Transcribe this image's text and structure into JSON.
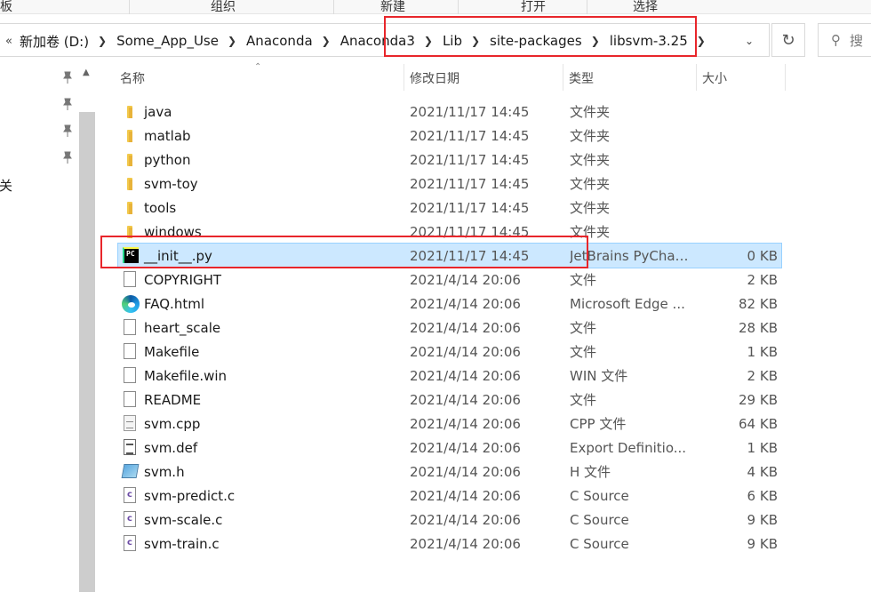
{
  "ribbon": {
    "groups": [
      "板",
      "组织",
      "新建",
      "打开",
      "选择"
    ]
  },
  "address": {
    "overflow": "«",
    "crumbs": [
      "新加卷 (D:)",
      "Some_App_Use",
      "Anaconda",
      "Anaconda3",
      "Lib",
      "site-packages",
      "libsvm-3.25"
    ],
    "dropdown_icon": "chevron-down-icon",
    "refresh_icon": "refresh-icon",
    "search_placeholder": "搜"
  },
  "nav": {
    "partial_label": "相关"
  },
  "columns": {
    "name": "名称",
    "date": "修改日期",
    "type": "类型",
    "size": "大小"
  },
  "files": [
    {
      "name": "java",
      "date": "2021/11/17 14:45",
      "type": "文件夹",
      "size": "",
      "icon": "folder-icon"
    },
    {
      "name": "matlab",
      "date": "2021/11/17 14:45",
      "type": "文件夹",
      "size": "",
      "icon": "folder-icon"
    },
    {
      "name": "python",
      "date": "2021/11/17 14:45",
      "type": "文件夹",
      "size": "",
      "icon": "folder-icon"
    },
    {
      "name": "svm-toy",
      "date": "2021/11/17 14:45",
      "type": "文件夹",
      "size": "",
      "icon": "folder-icon"
    },
    {
      "name": "tools",
      "date": "2021/11/17 14:45",
      "type": "文件夹",
      "size": "",
      "icon": "folder-icon"
    },
    {
      "name": "windows",
      "date": "2021/11/17 14:45",
      "type": "文件夹",
      "size": "",
      "icon": "folder-icon"
    },
    {
      "name": "__init__.py",
      "date": "2021/11/17 14:45",
      "type": "JetBrains PyChar...",
      "size": "0 KB",
      "icon": "pycharm-icon",
      "selected": true
    },
    {
      "name": "COPYRIGHT",
      "date": "2021/4/14 20:06",
      "type": "文件",
      "size": "2 KB",
      "icon": "file-icon"
    },
    {
      "name": "FAQ.html",
      "date": "2021/4/14 20:06",
      "type": "Microsoft Edge ...",
      "size": "82 KB",
      "icon": "edge-icon"
    },
    {
      "name": "heart_scale",
      "date": "2021/4/14 20:06",
      "type": "文件",
      "size": "28 KB",
      "icon": "file-icon"
    },
    {
      "name": "Makefile",
      "date": "2021/4/14 20:06",
      "type": "文件",
      "size": "1 KB",
      "icon": "file-icon"
    },
    {
      "name": "Makefile.win",
      "date": "2021/4/14 20:06",
      "type": "WIN 文件",
      "size": "2 KB",
      "icon": "file-icon"
    },
    {
      "name": "README",
      "date": "2021/4/14 20:06",
      "type": "文件",
      "size": "29 KB",
      "icon": "file-icon"
    },
    {
      "name": "svm.cpp",
      "date": "2021/4/14 20:06",
      "type": "CPP 文件",
      "size": "64 KB",
      "icon": "cpp-file-icon"
    },
    {
      "name": "svm.def",
      "date": "2021/4/14 20:06",
      "type": "Export Definitio...",
      "size": "1 KB",
      "icon": "def-file-icon"
    },
    {
      "name": "svm.h",
      "date": "2021/4/14 20:06",
      "type": "H 文件",
      "size": "4 KB",
      "icon": "header-file-icon"
    },
    {
      "name": "svm-predict.c",
      "date": "2021/4/14 20:06",
      "type": "C Source",
      "size": "6 KB",
      "icon": "c-source-icon"
    },
    {
      "name": "svm-scale.c",
      "date": "2021/4/14 20:06",
      "type": "C Source",
      "size": "9 KB",
      "icon": "c-source-icon"
    },
    {
      "name": "svm-train.c",
      "date": "2021/4/14 20:06",
      "type": "C Source",
      "size": "9 KB",
      "icon": "c-source-icon"
    }
  ],
  "colors": {
    "selection": "#cce8ff",
    "annotation": "#e8262b",
    "folder": "#f2c94c"
  }
}
